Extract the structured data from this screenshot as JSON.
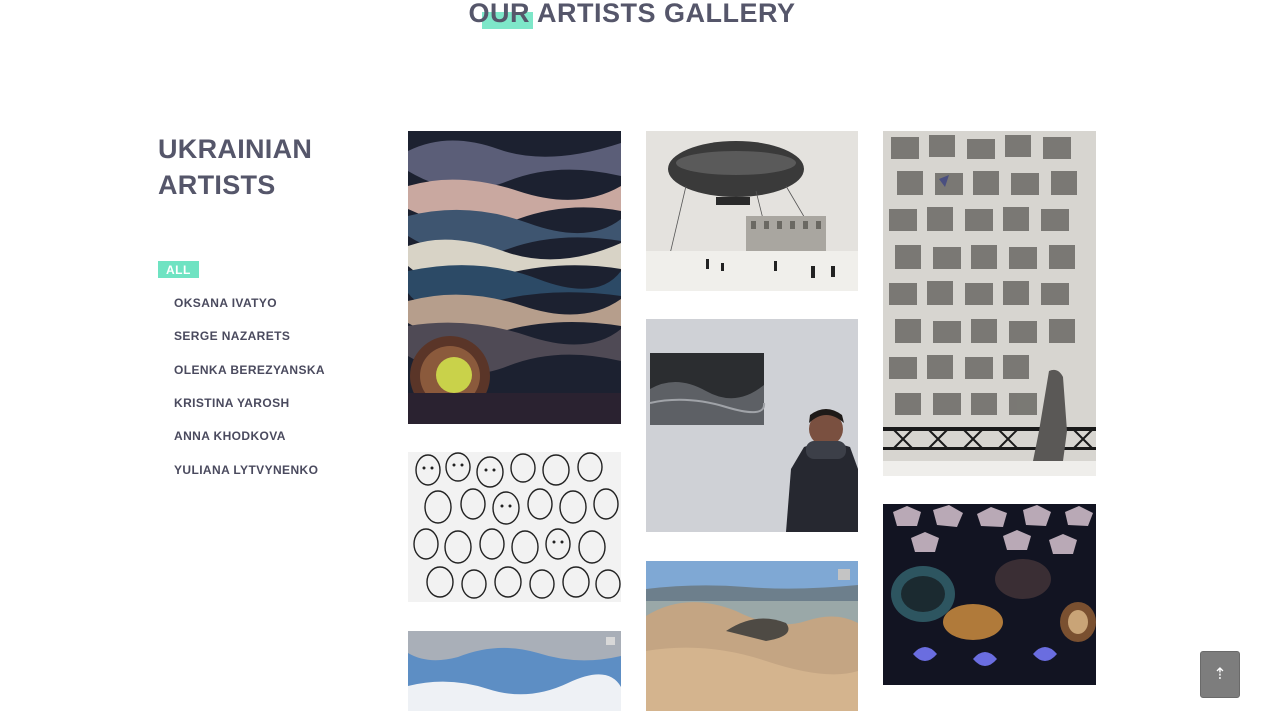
{
  "header": {
    "title": "OUR ARTISTS GALLERY"
  },
  "sidebar": {
    "heading_line1": "UKRAINIAN",
    "heading_line2": "ARTISTS",
    "filter_all": "ALL",
    "artists": [
      "OKSANA IVATYO",
      "SERGE NAZARETS",
      "OLENKA BEREZYANSKA",
      "KRISTINA YAROSH",
      "ANNA KHODKOVA",
      "YULIANA LYTVYNENKO"
    ]
  },
  "colors": {
    "accent": "#7ee7c9",
    "filter_active_bg": "#6fe3c2",
    "heading": "#55566a",
    "text": "#4a4a5e",
    "scroll_button": "#7d7d7d"
  },
  "gallery": {
    "artworks": [
      "night-clouds-painting",
      "zeppelin-etching",
      "windows-collage-print",
      "faces-crowd-drawing",
      "artist-portrait-photo",
      "patterned-stones-painting",
      "sky-clouds-painting",
      "mountain-landscape-painting"
    ]
  },
  "scroll_top": {
    "icon": "arrow-up-icon",
    "glyph": "⇡"
  }
}
